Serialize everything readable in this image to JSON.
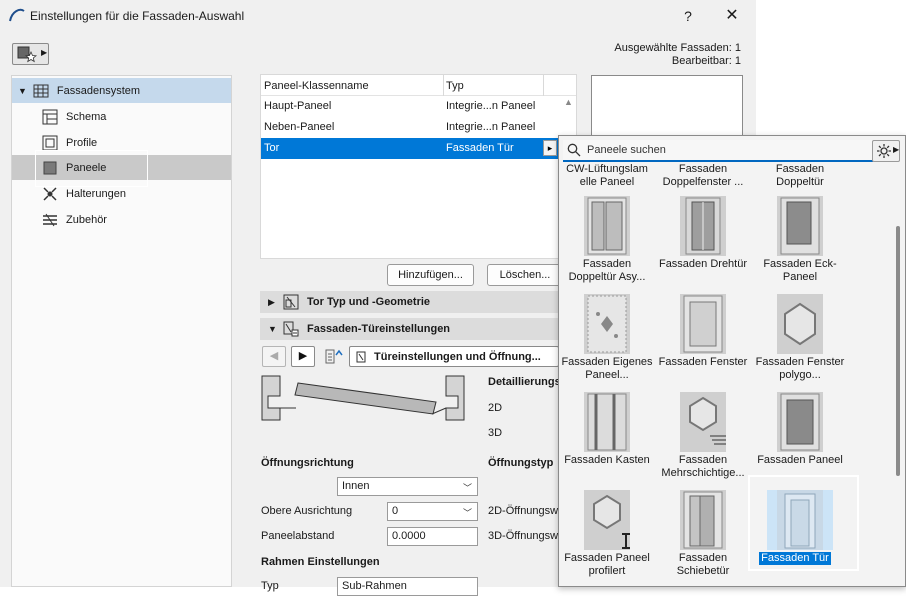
{
  "window": {
    "title": "Einstellungen für die Fassaden-Auswahl",
    "help_label": "?",
    "close_label": "✕"
  },
  "info": {
    "selected": "Ausgewählte Fassaden: 1",
    "editable": "Bearbeitbar: 1"
  },
  "sidebar": {
    "root": {
      "label": "Fassadensystem",
      "icon": "grid-icon"
    },
    "items": [
      {
        "label": "Schema",
        "icon": "schema-icon"
      },
      {
        "label": "Profile",
        "icon": "profile-icon"
      },
      {
        "label": "Paneele",
        "icon": "panel-icon",
        "selected": true
      },
      {
        "label": "Halterungen",
        "icon": "bracket-icon"
      },
      {
        "label": "Zubehör",
        "icon": "accessory-icon"
      }
    ]
  },
  "table": {
    "headers": [
      "Paneel-Klassenname",
      "Typ"
    ],
    "rows": [
      {
        "name": "Haupt-Paneel",
        "type": "Integrie...n Paneel"
      },
      {
        "name": "Neben-Paneel",
        "type": "Integrie...n Paneel"
      },
      {
        "name": "Tor",
        "type": "Fassaden Tür",
        "selected": true
      }
    ],
    "row_arrow": "▸"
  },
  "buttons": {
    "add": "Hinzufügen...",
    "delete": "Löschen..."
  },
  "sections": {
    "geometry": "Tor Typ und -Geometrie",
    "door_settings": "Fassaden-Türeinstellungen"
  },
  "nav": {
    "page_dropdown": "Türeinstellungen und Öffnung..."
  },
  "door": {
    "detail_label": "Detaillierungs",
    "view_2d": "2D",
    "view_3d": "3D",
    "opening_direction_label": "Öffnungsrichtung",
    "opening_type_label": "Öffnungstyp",
    "opening_direction_value": "Innen",
    "upper_alignment_label": "Obere Ausrichtung",
    "upper_alignment_value": "0",
    "panel_distance_label": "Paneelabstand",
    "panel_distance_value": "0.0000",
    "opening_2d_label": "2D-Öffnungsw",
    "opening_3d_label": "3D-Öffnungsw",
    "frame_settings_label": "Rahmen Einstellungen",
    "type_label": "Typ",
    "type_value": "Sub-Rahmen"
  },
  "popup": {
    "search_placeholder": "Paneele suchen",
    "top_row": [
      "CW-Lüftungslam elle Paneel",
      "Fassaden Doppelfenster ...",
      "Fassaden Doppeltür"
    ],
    "tiles": [
      {
        "name": "Fassaden Doppeltür Asy...",
        "icon": "double-door-asym-thumb"
      },
      {
        "name": "Fassaden Drehtür",
        "icon": "revolving-door-thumb"
      },
      {
        "name": "Fassaden Eck-Paneel",
        "icon": "corner-panel-thumb"
      },
      {
        "name": "Fassaden Eigenes Paneel...",
        "icon": "custom-panel-thumb"
      },
      {
        "name": "Fassaden Fenster",
        "icon": "window-thumb"
      },
      {
        "name": "Fassaden Fenster polygo...",
        "icon": "polygon-window-thumb"
      },
      {
        "name": "Fassaden Kasten",
        "icon": "box-thumb"
      },
      {
        "name": "Fassaden Mehrschichtige...",
        "icon": "multilayer-thumb"
      },
      {
        "name": "Fassaden Paneel",
        "icon": "panel-thumb"
      },
      {
        "name": "Fassaden Paneel profilert",
        "icon": "profiled-panel-thumb"
      },
      {
        "name": "Fassaden Schiebetür",
        "icon": "sliding-door-thumb"
      },
      {
        "name": "Fassaden Tür",
        "icon": "door-thumb",
        "selected": true
      }
    ]
  },
  "colors": {
    "accent": "#0078d7",
    "selection_light": "#cce4f7",
    "panel_bg": "#f0f0f0"
  }
}
